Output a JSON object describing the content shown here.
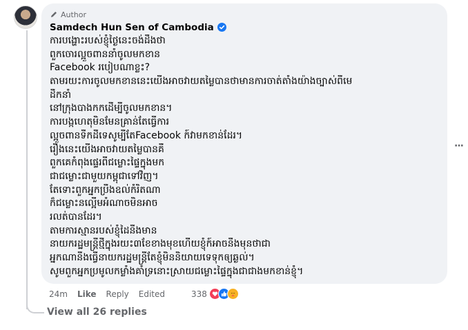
{
  "comment": {
    "author_label": "Author",
    "author_name": "Samdech Hun Sen of Cambodia",
    "verified_icon": "verified-badge-icon",
    "lines": [
      "ការបង្ហោះរបស់ខ្ញុំថ្ងៃនេះចង់ដឹងថា",
      "ពួកចោរល្អួចពាននាំចូលមកខាន",
      "Facebook របៀបណាខ្លះ?",
      "តាមរយះការចូលមកខាននេះយើងអាចវាយតម្លៃបានថាមានការចាត់តាំងយ៉ាងច្បាស់ពីមេ",
      "ដឹកនាំ",
      "នៅក្រុងបាងកកដើម្បីចូលមកខាន។",
      "ការបង្កហេតុមិនមែនគ្រាន់តែធ្វើការ",
      "ល្អួចពានទឹកដីទេសូម្បីតែFacebook ក៍វាមកខាន់ដែរ។",
      "រឿងនេះយើងអាចវាយតម្លៃបានគឺ",
      "ពួកគេកំពុងផ្ទេរពីជម្លោះផ្ទៃក្នុងមក",
      "ជាជម្លោះជាមួយកម្ពុជាទៅវិញ។",
      "តែទោះពួកអ្នកប្រឹងឧល់កំរិតណា",
      "ក៏ជម្លោះនល្អើមអំណាចមិនអាច",
      "រលត់បានដែរ។",
      "តាមការស្មានរបស់ខ្ញុំដៃនឹងមាន",
      "នាយករដ្ឋមន្ត្រីថ្មីក្នុងរយះ៣ខែខាងមុខហើយខ្ញុំក៍អាចនឹងមុនថាជា",
      "អ្នកណានឹងធ្វើនាយករដ្ឋមន្ត្រីតែខ្ញុំមិននិយាយទេទុកឲ្យឆ្ងល់។",
      "សូមពួកអ្នកប្រមូលកម្លាំងគាំទ្រនោះស្រាយជម្លោះផ្ទៃក្នុងជាជាងមកខាន់ខ្ញុំ។"
    ]
  },
  "actions": {
    "time": "24m",
    "like": "Like",
    "reply": "Reply",
    "edited": "Edited",
    "reaction_count": "338",
    "reactions": [
      "love",
      "like",
      "care"
    ]
  },
  "view_replies": "View all 26 replies",
  "colors": {
    "bubble_bg": "#f0f2f5",
    "meta_text": "#65676b",
    "verified": "#1877f2",
    "love": "#f33e58",
    "like": "#1877f2",
    "care": "#f7b125"
  }
}
